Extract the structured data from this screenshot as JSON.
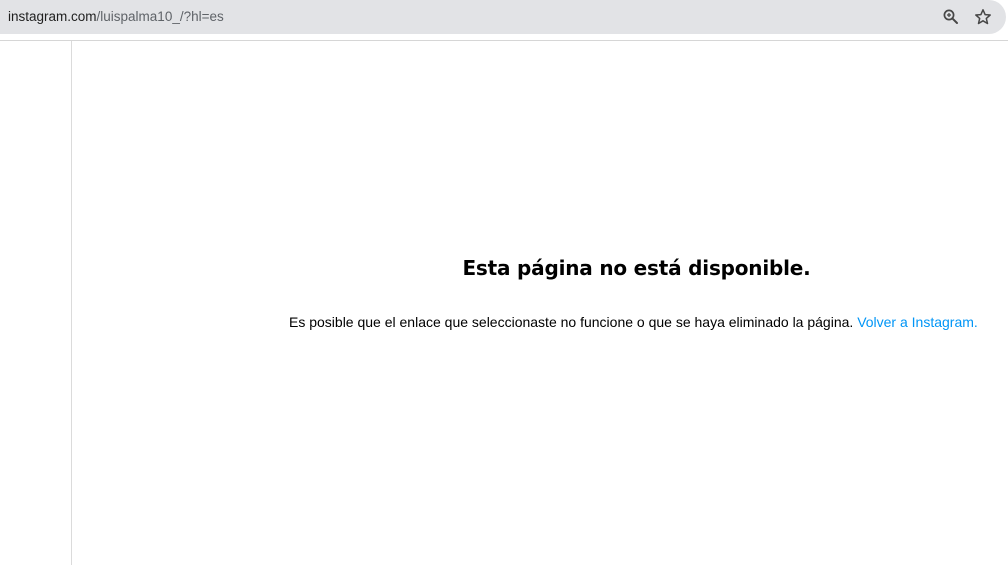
{
  "browser": {
    "url_host": "instagram.com",
    "url_path": "/luispalma10_/?hl=es",
    "icons": [
      "zoom-icon",
      "bookmark-star-icon"
    ]
  },
  "error_page": {
    "title": "Esta página no está disponible.",
    "message": "Es posible que el enlace que seleccionaste no funcione o que se haya eliminado la página.",
    "link_text": "Volver a Instagram."
  },
  "colors": {
    "omnibox_bg": "#e2e3e6",
    "link": "#0095f6",
    "divider": "#dbdbdb"
  }
}
